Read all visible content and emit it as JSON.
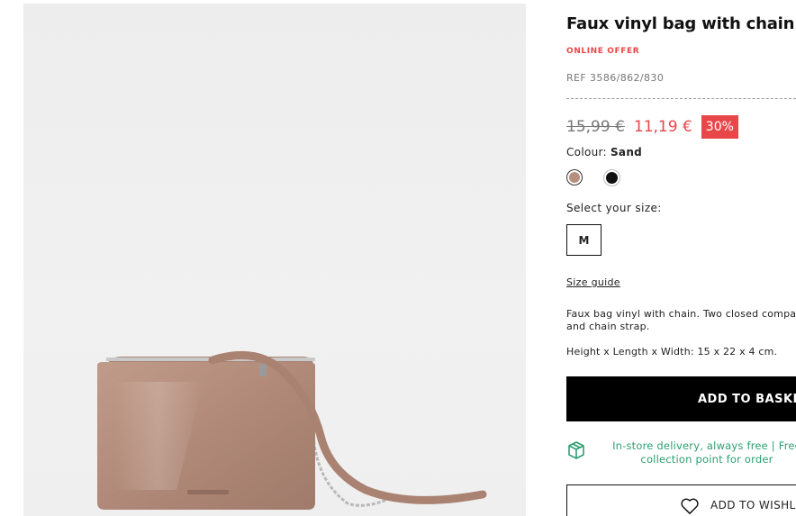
{
  "product": {
    "title": "Faux vinyl bag with chain",
    "badge": "ONLINE OFFER",
    "reference": "REF 3586/862/830",
    "price_old": "15,99 €",
    "price_new": "11,19 €",
    "discount": "30%",
    "colour_label": "Colour: ",
    "colour_value": "Sand",
    "colours": [
      {
        "name": "sand-swatch",
        "hex": "#b68f7e"
      },
      {
        "name": "black-swatch",
        "hex": "#111111"
      }
    ],
    "size_label": "Select your size:",
    "size_selected": "M",
    "size_guide": "Size guide",
    "description": "Faux bag vinyl with chain. Two closed compa and chain strap.",
    "dimensions": "Height x Length x Width: 15 x 22 x 4 cm.",
    "add_to_basket": "ADD TO BASKET",
    "delivery_line1": "In-store delivery, always free | Free",
    "delivery_line2": "collection point for order",
    "add_to_wishlist": "ADD TO WISHLIST",
    "delivery_icon": "box-icon",
    "wishlist_icon": "heart-icon"
  },
  "colors": {
    "accent": "#e8474a",
    "green": "#2aa072",
    "bag": "#b68f7e"
  }
}
